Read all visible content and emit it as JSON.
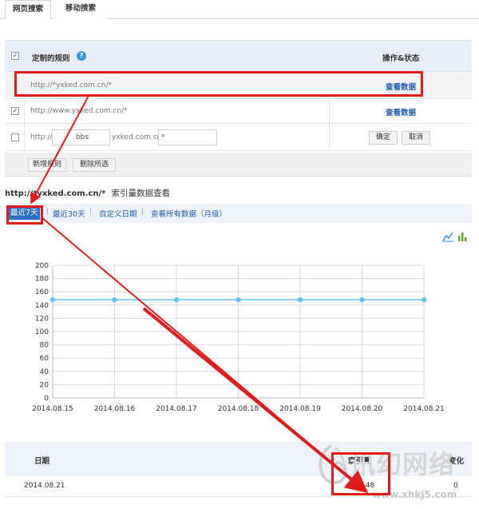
{
  "tabs": [
    "网页搜索",
    "移动搜索"
  ],
  "rules_table": {
    "header": "定制的规则",
    "help_icon": "question-circle-icon",
    "action_header": "操作&状态",
    "rows": [
      {
        "url": "http://*yxked.com.cn/*",
        "checked": false,
        "action": "查看数据"
      },
      {
        "url": "http://www.yxked.com.cn/*",
        "checked": true,
        "action": "查看数据"
      }
    ],
    "new_rule": {
      "prefix": "http://",
      "subdomain": "bbs",
      "mid": "yxked.com.cn/",
      "path": "*",
      "confirm": "确定",
      "cancel": "取消"
    }
  },
  "actions": {
    "add_rule": "新增规则",
    "delete_selected": "删除所选"
  },
  "data_view": {
    "url": "http://*yxked.com.cn/*",
    "title": "索引量数据查看",
    "ranges": [
      "最近7天",
      "最近30天",
      "自定义日期",
      "查看所有数据（月级）"
    ],
    "active_range": "最近7天"
  },
  "chart_data": {
    "type": "line",
    "x": [
      "2014.08.15",
      "2014.08.16",
      "2014.08.17",
      "2014.08.18",
      "2014.08.19",
      "2014.08.20",
      "2014.08.21"
    ],
    "series": [
      {
        "values": [
          148,
          148,
          148,
          148,
          148,
          148,
          148
        ]
      }
    ],
    "ylim": [
      0,
      200
    ],
    "yticks": [
      0,
      20,
      40,
      60,
      80,
      100,
      120,
      140,
      160,
      180,
      200
    ],
    "color": "#5bc4f0",
    "grid": true
  },
  "bottom_table": {
    "headers": {
      "date": "日期",
      "index": "索引量",
      "change": "变化"
    },
    "rows": [
      {
        "date": "2014.08.21",
        "index": "148",
        "change": "0"
      }
    ]
  },
  "watermark": {
    "logo": "讯幻网络",
    "url": "www.xhkj5.com"
  },
  "colors": {
    "link": "#1f5fbf",
    "annotation": "#e21a1a",
    "line": "#5bc4f0"
  }
}
